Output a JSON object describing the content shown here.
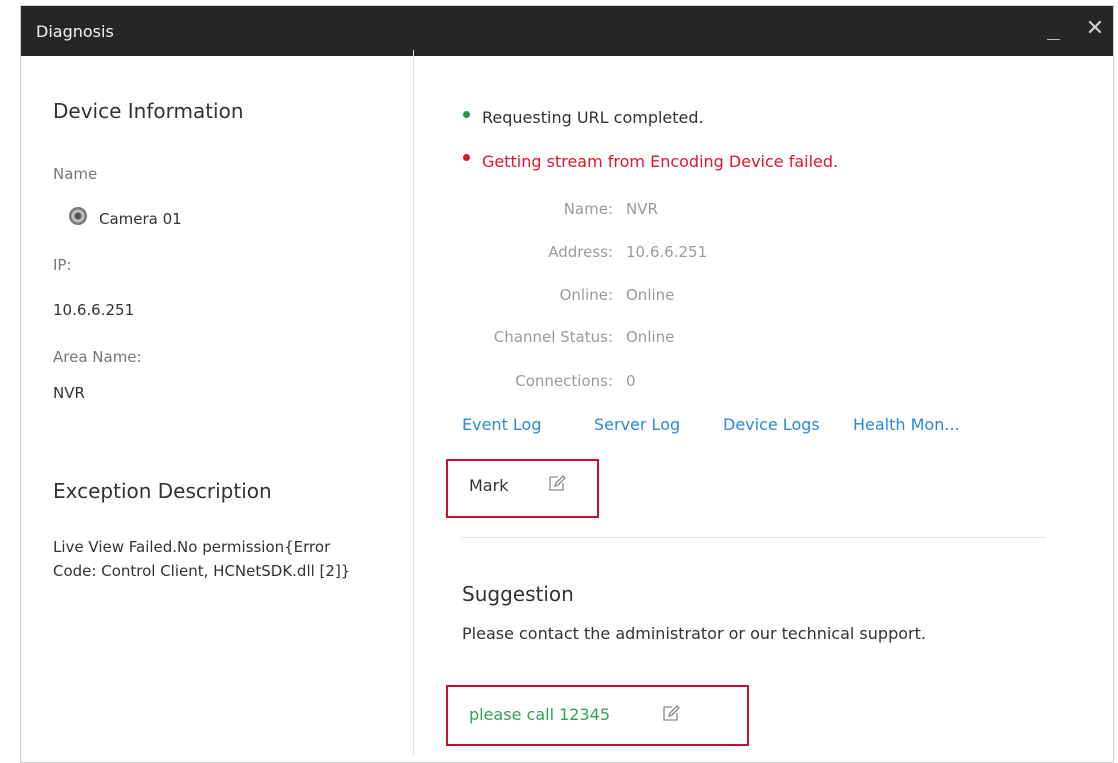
{
  "window": {
    "title": "Diagnosis",
    "minimize_icon": "minimize-icon",
    "close_glyph": "✕"
  },
  "device_info": {
    "heading": "Device Information",
    "name_label": "Name",
    "camera_name": "Camera 01",
    "camera_icon": "camera-icon",
    "ip_label": "IP:",
    "ip_value": "10.6.6.251",
    "area_label": "Area Name:",
    "area_value": "NVR"
  },
  "exception": {
    "heading": "Exception Description",
    "text": "Live View Failed.No permission{Error Code: Control Client, HCNetSDK.dll [2]}"
  },
  "status": {
    "ok_text": "Requesting URL completed.",
    "ok_color": "#1f9a4d",
    "fail_text": "Getting stream from Encoding Device failed.",
    "fail_color": "#e0162b"
  },
  "device_details": [
    {
      "label": "Name:",
      "value": "NVR"
    },
    {
      "label": "Address:",
      "value": "10.6.6.251"
    },
    {
      "label": "Online:",
      "value": "Online"
    },
    {
      "label": "Channel Status:",
      "value": "Online"
    },
    {
      "label": "Connections:",
      "value": "0"
    }
  ],
  "links": {
    "event_log": "Event Log",
    "server_log": "Server Log",
    "device_logs": "Device Logs",
    "health_monitor": "Health Mon..."
  },
  "mark": {
    "label": "Mark",
    "icon": "edit-icon"
  },
  "suggestion": {
    "heading": "Suggestion",
    "text": "Please contact the administrator or our technical support.",
    "custom_note": "please call 12345",
    "icon": "edit-icon"
  },
  "colors": {
    "titlebar": "#262626",
    "link": "#2b8ad6",
    "highlight": "#c8102e",
    "note": "#2fa35a"
  }
}
